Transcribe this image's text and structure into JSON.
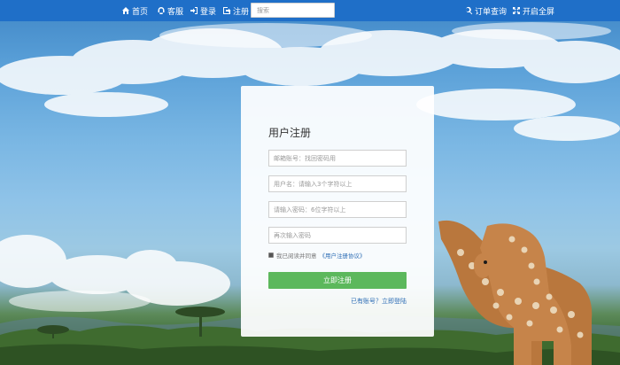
{
  "nav": {
    "home": "首页",
    "service": "客服",
    "login": "登录",
    "register": "注册",
    "search_placeholder": "搜索",
    "order_query": "订单查询",
    "fullscreen": "开启全屏"
  },
  "form": {
    "title": "用户注册",
    "email_placeholder": "邮箱账号：找回密码用",
    "username_placeholder": "用户名：请输入3个字符以上",
    "password_placeholder": "请输入密码：6位字符以上",
    "confirm_placeholder": "再次输入密码",
    "agree_text": "我已阅读并同意",
    "agree_link": "《用户注册协议》",
    "submit_label": "立即注册",
    "login_link": "已有账号？立即登陆"
  },
  "colors": {
    "navbar": "#1f6fc8",
    "submit": "#5cb85c",
    "link": "#2d6db5"
  }
}
